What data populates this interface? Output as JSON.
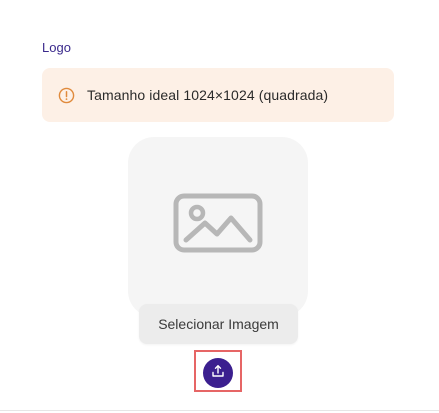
{
  "field": {
    "label": "Logo"
  },
  "alert": {
    "text": "Tamanho ideal 1024×1024 (quadrada)",
    "icon": "warning-circle-icon",
    "background": "#fdf0e6",
    "icon_color": "#e08a3c"
  },
  "image_preview": {
    "icon": "image-placeholder-icon"
  },
  "upload": {
    "tooltip": "Selecionar Imagem",
    "icon": "upload-icon",
    "accent": "#3b1f8f",
    "highlight_color": "#e66565"
  }
}
